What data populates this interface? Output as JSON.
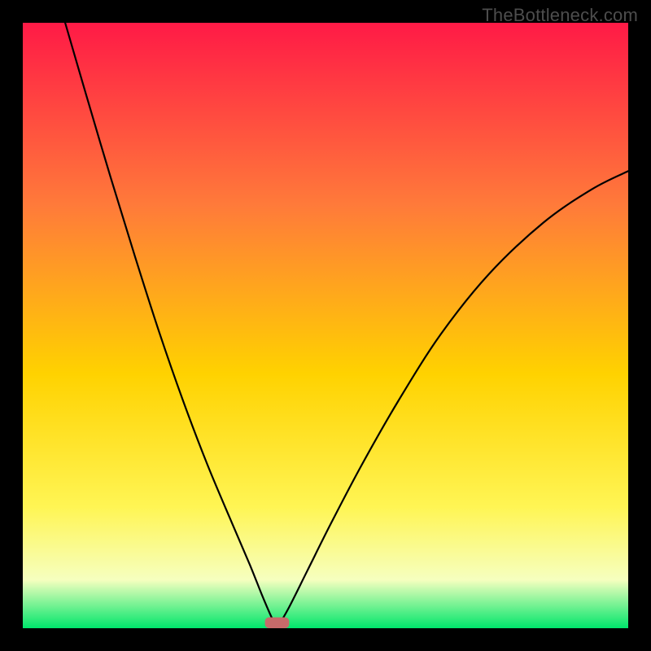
{
  "watermark": "TheBottleneck.com",
  "colors": {
    "frame": "#000000",
    "gradient": {
      "top": "#ff1a46",
      "upper_mid": "#ff7a3a",
      "mid": "#ffd200",
      "lower_mid": "#fff554",
      "pale": "#f6ffbf",
      "bottom": "#00e66b"
    },
    "curve": "#000000",
    "marker": "#c76a6a"
  },
  "chart_data": {
    "type": "line",
    "title": "",
    "xlabel": "",
    "ylabel": "",
    "xlim": [
      0,
      100
    ],
    "ylim": [
      0,
      100
    ],
    "optimum_x": 42,
    "marker": {
      "x_start": 40.0,
      "x_end": 44.0,
      "y": 0,
      "height": 1.8
    },
    "series": [
      {
        "name": "left-branch",
        "x": [
          7.0,
          10.5,
          14.5,
          18.5,
          22.5,
          26.5,
          30.5,
          34.5,
          37.5,
          39.5,
          41.0,
          42.0
        ],
        "y": [
          100,
          88.0,
          74.5,
          61.5,
          49.0,
          37.5,
          27.0,
          17.5,
          10.5,
          5.5,
          2.0,
          0.0
        ]
      },
      {
        "name": "right-branch",
        "x": [
          42.0,
          44.0,
          47.0,
          51.0,
          56.0,
          62.0,
          69.0,
          77.0,
          86.0,
          94.0,
          100.0
        ],
        "y": [
          0.0,
          3.5,
          9.5,
          17.5,
          27.0,
          37.5,
          48.5,
          58.5,
          67.0,
          72.5,
          75.5
        ]
      }
    ]
  }
}
